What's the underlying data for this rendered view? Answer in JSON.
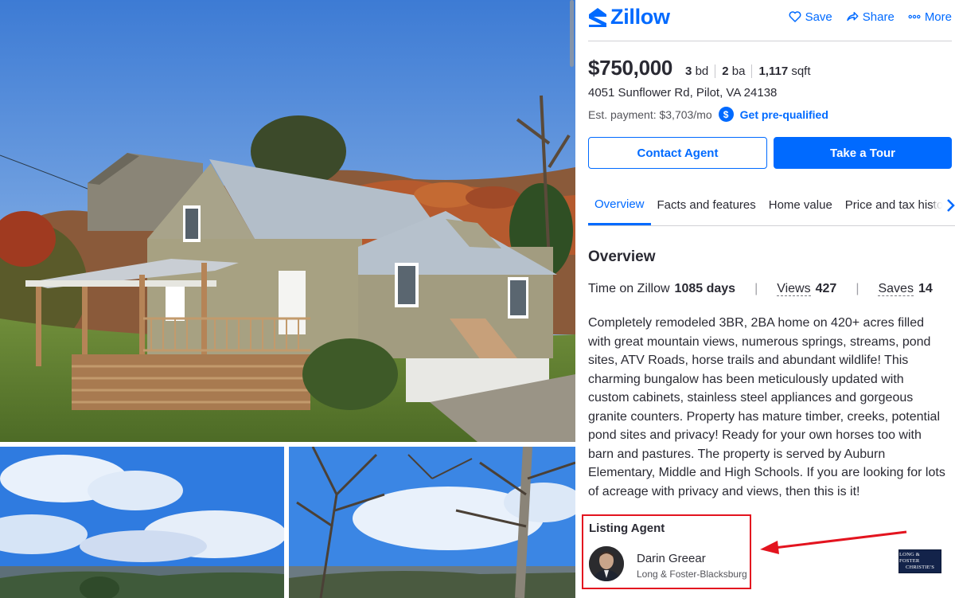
{
  "header": {
    "logo_text": "Zillow",
    "actions": [
      {
        "label": "Save",
        "icon": "heart-icon"
      },
      {
        "label": "Share",
        "icon": "share-icon"
      },
      {
        "label": "More",
        "icon": "more-dots-icon"
      }
    ]
  },
  "listing": {
    "price": "$750,000",
    "beds_value": "3",
    "beds_unit": "bd",
    "baths_value": "2",
    "baths_unit": "ba",
    "sqft_value": "1,117",
    "sqft_unit": "sqft",
    "address": "4051 Sunflower Rd, Pilot, VA 24138",
    "est_payment": "Est. payment: $3,703/mo",
    "prequalified_link": "Get pre-qualified"
  },
  "buttons": {
    "contact": "Contact Agent",
    "tour": "Take a Tour"
  },
  "tabs": [
    "Overview",
    "Facts and features",
    "Home value",
    "Price and tax history"
  ],
  "overview": {
    "title": "Overview",
    "time_label": "Time on Zillow",
    "time_value": "1085 days",
    "views_label": "Views",
    "views_value": "427",
    "saves_label": "Saves",
    "saves_value": "14",
    "description": "Completely remodeled 3BR, 2BA home on 420+ acres filled with great mountain views, numerous springs, streams, pond sites, ATV Roads, horse trails and abundant wildlife! This charming bungalow has been meticulously updated with custom cabinets, stainless steel appliances and gorgeous granite counters. Property has mature timber, creeks, potential pond sites and privacy! Ready for your own horses too with barn and pastures. The property is served by Auburn Elementary, Middle and High Schools. If you are looking for lots of acreage with privacy and views, then this is it!"
  },
  "agent": {
    "heading": "Listing Agent",
    "name": "Darin Greear",
    "brokerage": "Long & Foster-Blacksburg",
    "broker_logo_lines": [
      "LONG & FOSTER",
      "CHRISTIE'S"
    ]
  },
  "colors": {
    "brand_blue": "#006aff",
    "highlight_red": "#e3141f"
  }
}
